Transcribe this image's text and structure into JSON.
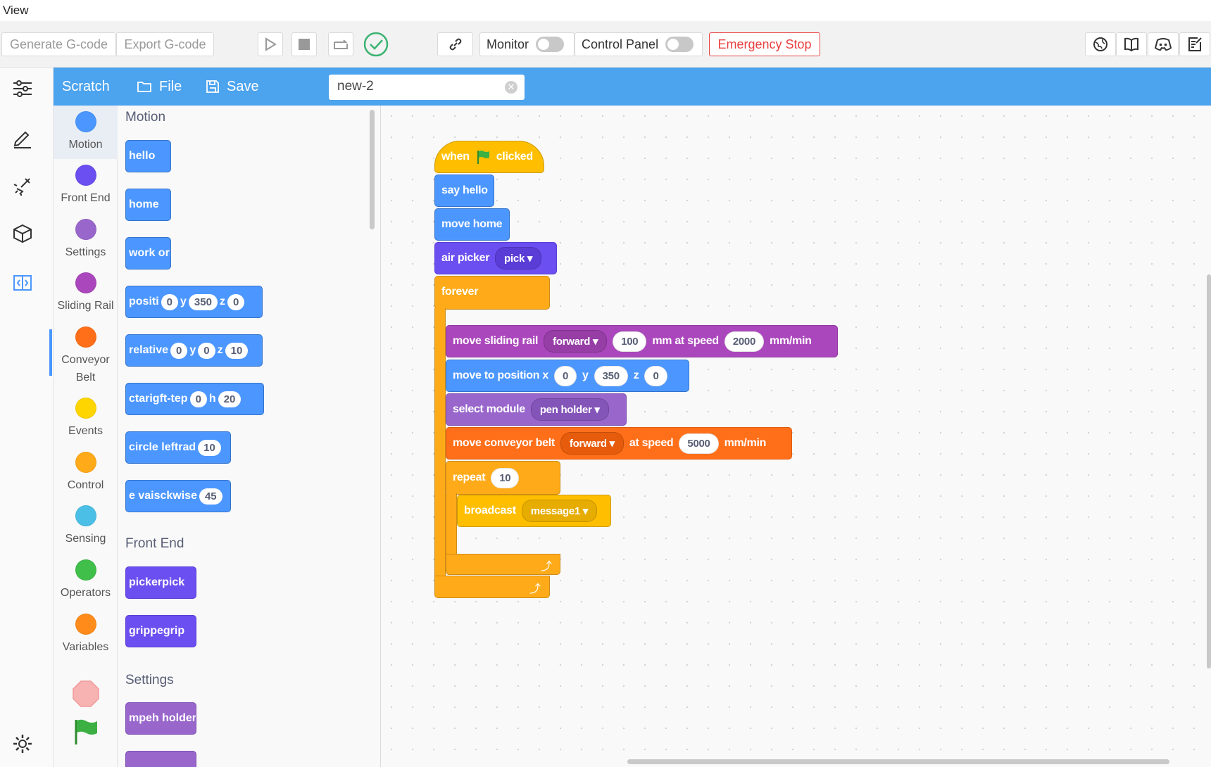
{
  "menubar": {
    "view": "View"
  },
  "toolbar": {
    "generate_gcode": "Generate G-code",
    "export_gcode": "Export G-code",
    "monitor": "Monitor",
    "control_panel": "Control Panel",
    "emergency_stop": "Emergency Stop"
  },
  "scratchbar": {
    "title": "Scratch",
    "file": "File",
    "save": "Save",
    "filename": "new-2"
  },
  "categories": [
    {
      "label": "Motion",
      "color": "#4c97ff"
    },
    {
      "label": "Front End",
      "color": "#6c4ff0"
    },
    {
      "label": "Settings",
      "color": "#9966cc"
    },
    {
      "label": "Sliding Rail",
      "color": "#ab47bc"
    },
    {
      "label": "Conveyor Belt",
      "color": "#ff6f1a"
    },
    {
      "label": "Events",
      "color": "#ffd500"
    },
    {
      "label": "Control",
      "color": "#ffab19"
    },
    {
      "label": "Sensing",
      "color": "#4cbfe6"
    },
    {
      "label": "Operators",
      "color": "#40bf4a"
    },
    {
      "label": "Variables",
      "color": "#ff8c1a"
    }
  ],
  "palette": {
    "motion_head": "Motion",
    "frontend_head": "Front End",
    "settings_head": "Settings",
    "b1": "hello",
    "b2": "home",
    "b3": "work ori",
    "b4_a": "positi",
    "b4_v1": "0",
    "b4_b": "y",
    "b4_v2": "350",
    "b4_c": "z",
    "b4_v3": "0",
    "b5_a": "relative",
    "b5_v1": "0",
    "b5_b": "y",
    "b5_v2": "0",
    "b5_c": "z",
    "b5_v3": "10",
    "b6_a": "ctarigft-tep",
    "b6_v1": "0",
    "b6_b": "h",
    "b6_v2": "20",
    "b7_a": "circle leftrad",
    "b7_v1": "10",
    "b8_a": "e vaisckwise",
    "b8_v1": "45",
    "f1": "pickerpick",
    "f2": "grippegrip",
    "s1": "mpeh holder"
  },
  "script": {
    "hat_when": "when",
    "hat_clicked": "clicked",
    "say": "say hello",
    "move_home": "move home",
    "air_picker": "air picker",
    "air_picker_value": "pick",
    "forever": "forever",
    "rail_label": "move sliding rail",
    "rail_dir": "forward",
    "rail_dist": "100",
    "rail_mid": "mm at speed",
    "rail_speed": "2000",
    "rail_unit": "mm/min",
    "pos_label": "move to position x",
    "pos_x": "0",
    "pos_y_label": "y",
    "pos_y": "350",
    "pos_z_label": "z",
    "pos_z": "0",
    "module_label": "select module",
    "module_value": "pen holder",
    "belt_label": "move conveyor belt",
    "belt_dir": "forward",
    "belt_mid": "at speed",
    "belt_speed": "5000",
    "belt_unit": "mm/min",
    "repeat_label": "repeat",
    "repeat_count": "10",
    "broadcast_label": "broadcast",
    "broadcast_value": "message1"
  }
}
